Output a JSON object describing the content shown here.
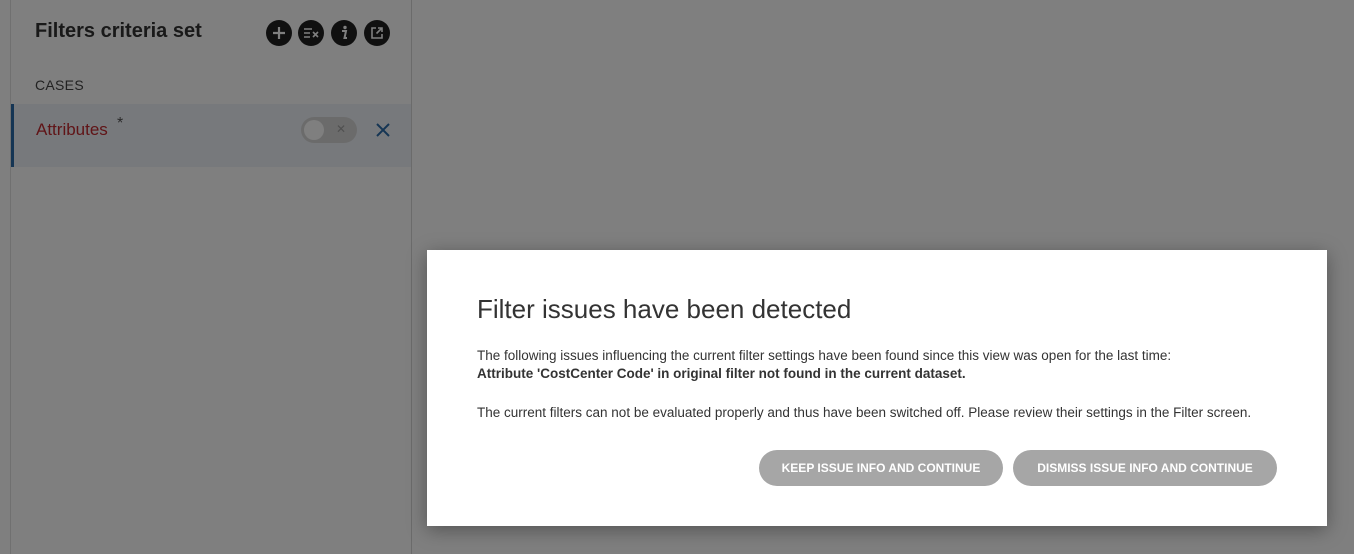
{
  "panel": {
    "title": "Filters criteria set",
    "toolbar": {
      "add_icon": "plus-icon",
      "clear_icon": "clear-filters-icon",
      "info_icon": "info-icon",
      "export_icon": "open-external-icon"
    },
    "section_label": "CASES",
    "filters": [
      {
        "name": "Attributes",
        "marker": "*",
        "enabled": false
      }
    ]
  },
  "dialog": {
    "title": "Filter issues have been detected",
    "line1": "The following issues influencing the current filter settings have been found since this view was open for the last time:",
    "issue": "Attribute 'CostCenter Code' in original filter not found in the current dataset.",
    "line2": "The current filters can not be evaluated properly and thus have been switched off. Please review their settings in the Filter screen.",
    "keep_button": "KEEP ISSUE INFO AND CONTINUE",
    "dismiss_button": "DISMISS ISSUE INFO AND CONTINUE"
  },
  "colors": {
    "accent": "#2a6aa8",
    "filter_name": "#c0282e",
    "button": "#a6a6a6",
    "overlay": "rgba(0,0,0,0.5)"
  }
}
